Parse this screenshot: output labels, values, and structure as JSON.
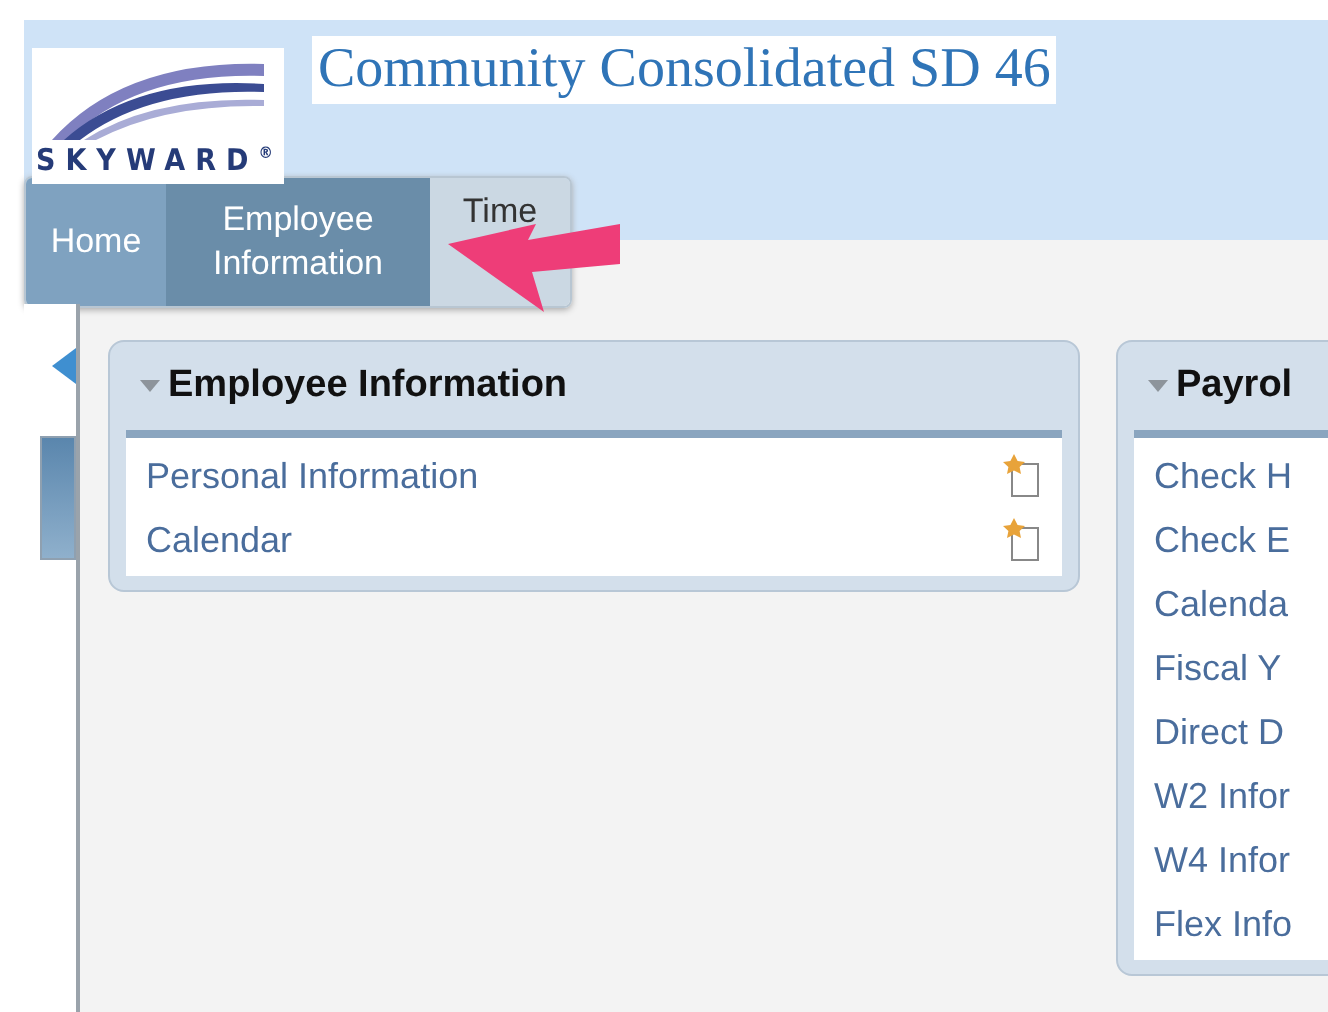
{
  "logo": {
    "text": "SKYWARD",
    "mark": "®"
  },
  "title": "Community Consolidated SD 46",
  "tabs": [
    {
      "lines": [
        "Home"
      ],
      "selected": false
    },
    {
      "lines": [
        "Employee",
        "Information"
      ],
      "selected": true
    },
    {
      "lines": [
        "Time"
      ],
      "selected": false
    }
  ],
  "cards": [
    {
      "title": "Employee Information",
      "expanded": true,
      "items": [
        {
          "label": "Personal Information",
          "icon": true
        },
        {
          "label": "Calendar",
          "icon": true
        }
      ]
    },
    {
      "title": "Payrol",
      "expanded": true,
      "items": [
        {
          "label": "Check H",
          "icon": false
        },
        {
          "label": "Check E",
          "icon": false
        },
        {
          "label": "Calenda",
          "icon": false
        },
        {
          "label": "Fiscal Y",
          "icon": false
        },
        {
          "label": "Direct D",
          "icon": false
        },
        {
          "label": "W2 Infor",
          "icon": false
        },
        {
          "label": "W4 Infor",
          "icon": false
        },
        {
          "label": "Flex Info",
          "icon": false
        }
      ]
    }
  ]
}
